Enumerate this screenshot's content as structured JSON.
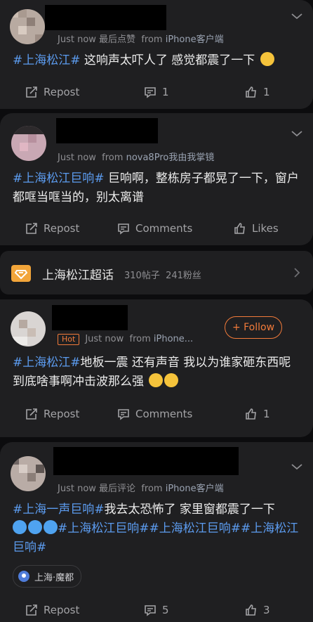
{
  "posts": [
    {
      "meta_time": "Just now",
      "meta_action": "最后点赞",
      "meta_from": "from",
      "meta_source": "iPhone客户端",
      "text_tag": "#上海松江#",
      "text_body": " 这响声太吓人了 感觉都震了一下",
      "emoji": "crying-face",
      "repost_label": "Repost",
      "comment_label": "1",
      "like_label": "1"
    },
    {
      "meta_time": "Just now",
      "meta_from": "from",
      "meta_source": "nova8Pro我由我掌镜",
      "text_tag": "#上海松江巨响#",
      "text_body": " 巨响啊，整栋房子都晃了一下，窗户都哐当哐当的，别太离谱",
      "repost_label": "Repost",
      "comment_label": "Comments",
      "like_label": "Likes"
    },
    {
      "hot_label": "Hot",
      "meta_time": "Just now",
      "meta_from": "from",
      "meta_source": "iPhone...",
      "follow_label": "+ Follow",
      "text_tag": "#上海松江#",
      "text_body": "地板一震 还有声音 我以为谁家砸东西呢 到底啥事啊冲击波那么强",
      "emoji": "sad-face",
      "repost_label": "Repost",
      "comment_label": "Comments",
      "like_label": "1"
    },
    {
      "meta_time": "Just now",
      "meta_action": "最后评论",
      "meta_from": "from",
      "meta_source": "iPhone客户端",
      "text_tag": "#上海一声巨响#",
      "text_body": "我去太恐怖了 家里窗都震了一下",
      "emoji": "fearful-face",
      "text_tags_tail": "#上海松江巨响##上海松江巨响##上海松江巨响#",
      "location": "上海·魔都",
      "repost_label": "Repost",
      "comment_label": "5",
      "like_label": "3"
    }
  ],
  "topic": {
    "title": "上海松江超话",
    "posts_count": "310帖子",
    "fans_count": "241粉丝"
  },
  "colors": {
    "accent_link": "#5c9cf0",
    "accent_orange": "#f27b3a",
    "card": "#1f1f21",
    "page": "#0c0c0e"
  }
}
